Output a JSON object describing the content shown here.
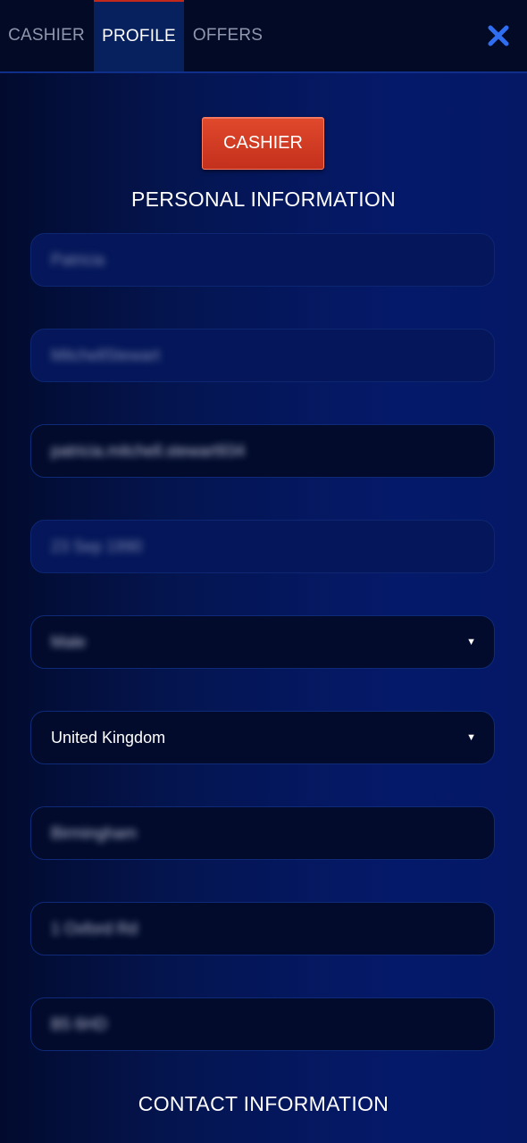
{
  "tabs": [
    {
      "label": "CASHIER",
      "active": false
    },
    {
      "label": "PROFILE",
      "active": true
    },
    {
      "label": "OFFERS",
      "active": false
    }
  ],
  "cashier_button": "CASHIER",
  "personal_title": "PERSONAL INFORMATION",
  "fields": {
    "first_name": "Patricia",
    "last_name": "MitchellStewart",
    "email": "patricia.mitchell.stewart934",
    "birth_date": "23 Sep 1990",
    "gender": "Male",
    "country": "United Kingdom",
    "city": "Birmingham",
    "address": "1 Oxford Rd",
    "postcode": "B5 6HD"
  },
  "contact_title": "CONTACT INFORMATION",
  "colors": {
    "accent_red": "#d23c22",
    "close_blue": "#2f6ef0",
    "background": "#041551"
  }
}
